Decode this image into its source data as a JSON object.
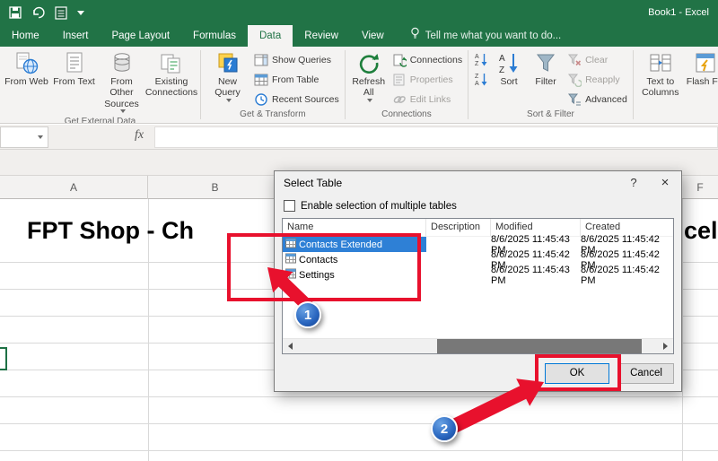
{
  "window": {
    "title": "Book1 - Excel"
  },
  "ribbon": {
    "tabs": [
      {
        "label": "Home"
      },
      {
        "label": "Insert"
      },
      {
        "label": "Page Layout"
      },
      {
        "label": "Formulas"
      },
      {
        "label": "Data"
      },
      {
        "label": "Review"
      },
      {
        "label": "View"
      }
    ],
    "tell_me": "Tell me what you want to do...",
    "groups": {
      "external": {
        "label": "Get External Data",
        "from_web": "From Web",
        "from_text": "From Text",
        "from_other": "From Other Sources",
        "existing": "Existing Connections"
      },
      "transform": {
        "label": "Get & Transform",
        "new_query": "New Query",
        "show_queries": "Show Queries",
        "from_table": "From Table",
        "recent_sources": "Recent Sources"
      },
      "connections": {
        "label": "Connections",
        "refresh_all": "Refresh All",
        "connections": "Connections",
        "properties": "Properties",
        "edit_links": "Edit Links"
      },
      "sort_filter": {
        "label": "Sort & Filter",
        "sort": "Sort",
        "filter": "Filter",
        "clear": "Clear",
        "reapply": "Reapply",
        "advanced": "Advanced"
      },
      "data_tools": {
        "text_to_columns": "Text to Columns",
        "flash_fill": "Flash Fill"
      }
    }
  },
  "formula_bar": {
    "fx": "fx"
  },
  "sheet": {
    "col_a": "A",
    "col_b": "B",
    "col_f": "F",
    "title_left": "FPT Shop - Ch",
    "title_right": "cel"
  },
  "dialog": {
    "title": "Select Table",
    "help": "?",
    "close": "×",
    "checkbox_label": "Enable selection of multiple tables",
    "columns": [
      "Name",
      "Description",
      "Modified",
      "Created"
    ],
    "rows": [
      {
        "name": "Contacts Extended",
        "description": "",
        "modified": "8/6/2025 11:45:43 PM",
        "created": "8/6/2025 11:45:42 PM"
      },
      {
        "name": "Contacts",
        "description": "",
        "modified": "8/6/2025 11:45:42 PM",
        "created": "8/6/2025 11:45:42 PM"
      },
      {
        "name": "Settings",
        "description": "",
        "modified": "8/6/2025 11:45:43 PM",
        "created": "8/6/2025 11:45:42 PM"
      }
    ],
    "ok": "OK",
    "cancel": "Cancel"
  },
  "annotations": {
    "step1": "1",
    "step2": "2"
  }
}
